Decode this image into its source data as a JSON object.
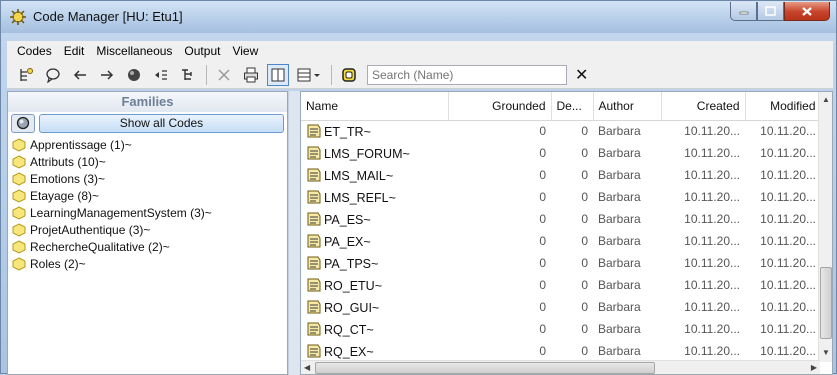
{
  "window": {
    "title": "Code Manager [HU: Etu1]"
  },
  "menu": [
    "Codes",
    "Edit",
    "Miscellaneous",
    "Output",
    "View"
  ],
  "toolbar": {
    "icons": [
      "new-code-icon",
      "comment-icon",
      "back-icon",
      "forward-icon",
      "network-icon",
      "filter-icon",
      "tree-icon",
      "delete-icon",
      "print-icon",
      "single-pane-icon",
      "view-options-icon",
      "code-family-icon"
    ],
    "search_placeholder": "Search (Name)",
    "clear_glyph": "✕"
  },
  "families": {
    "header": "Families",
    "show_all": "Show all Codes",
    "items": [
      "Apprentissage (1)~",
      "Attributs (10)~",
      "Emotions (3)~",
      "Etayage (8)~",
      "LearningManagementSystem (3)~",
      "ProjetAuthentique (3)~",
      "RechercheQualitative (2)~",
      "Roles (2)~"
    ]
  },
  "codes": {
    "columns": [
      "Name",
      "Grounded",
      "De...",
      "Author",
      "Created",
      "Modified"
    ],
    "rows": [
      {
        "name": "ET_TR~",
        "grounded": "0",
        "density": "0",
        "author": "Barbara",
        "created": "10.11.20...",
        "modified": "10.11.20..."
      },
      {
        "name": "LMS_FORUM~",
        "grounded": "0",
        "density": "0",
        "author": "Barbara",
        "created": "10.11.20...",
        "modified": "10.11.20..."
      },
      {
        "name": "LMS_MAIL~",
        "grounded": "0",
        "density": "0",
        "author": "Barbara",
        "created": "10.11.20...",
        "modified": "10.11.20..."
      },
      {
        "name": "LMS_REFL~",
        "grounded": "0",
        "density": "0",
        "author": "Barbara",
        "created": "10.11.20...",
        "modified": "10.11.20..."
      },
      {
        "name": "PA_ES~",
        "grounded": "0",
        "density": "0",
        "author": "Barbara",
        "created": "10.11.20...",
        "modified": "10.11.20..."
      },
      {
        "name": "PA_EX~",
        "grounded": "0",
        "density": "0",
        "author": "Barbara",
        "created": "10.11.20...",
        "modified": "10.11.20..."
      },
      {
        "name": "PA_TPS~",
        "grounded": "0",
        "density": "0",
        "author": "Barbara",
        "created": "10.11.20...",
        "modified": "10.11.20..."
      },
      {
        "name": "RO_ETU~",
        "grounded": "0",
        "density": "0",
        "author": "Barbara",
        "created": "10.11.20...",
        "modified": "10.11.20..."
      },
      {
        "name": "RO_GUI~",
        "grounded": "0",
        "density": "0",
        "author": "Barbara",
        "created": "10.11.20...",
        "modified": "10.11.20..."
      },
      {
        "name": "RQ_CT~",
        "grounded": "0",
        "density": "0",
        "author": "Barbara",
        "created": "10.11.20...",
        "modified": "10.11.20..."
      },
      {
        "name": "RQ_EX~",
        "grounded": "0",
        "density": "0",
        "author": "Barbara",
        "created": "10.11.20...",
        "modified": "10.11.20..."
      }
    ]
  },
  "colors": {
    "accent": "#4d86c9",
    "family_header": "#6d7f96",
    "close": "#c7432a"
  }
}
